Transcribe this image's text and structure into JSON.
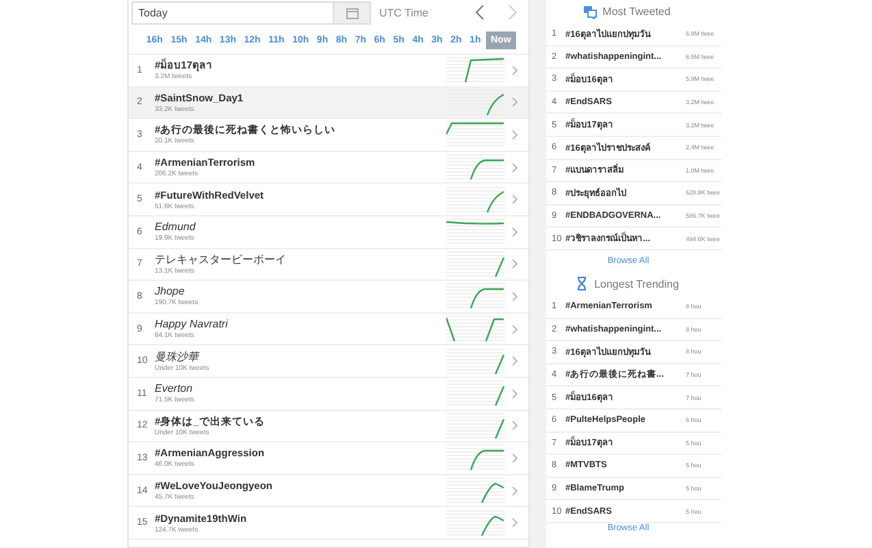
{
  "toolbar": {
    "date_field": {
      "value": "Today"
    },
    "timezone_label": "UTC Time"
  },
  "hours": [
    {
      "label": "16h",
      "selected": false
    },
    {
      "label": "15h",
      "selected": false
    },
    {
      "label": "14h",
      "selected": false
    },
    {
      "label": "13h",
      "selected": false
    },
    {
      "label": "12h",
      "selected": false
    },
    {
      "label": "11h",
      "selected": false
    },
    {
      "label": "10h",
      "selected": false
    },
    {
      "label": "9h",
      "selected": false
    },
    {
      "label": "8h",
      "selected": false
    },
    {
      "label": "7h",
      "selected": false
    },
    {
      "label": "6h",
      "selected": false
    },
    {
      "label": "5h",
      "selected": false
    },
    {
      "label": "4h",
      "selected": false
    },
    {
      "label": "3h",
      "selected": false
    },
    {
      "label": "2h",
      "selected": false
    },
    {
      "label": "1h",
      "selected": false
    },
    {
      "label": "Now",
      "selected": true
    }
  ],
  "trends": [
    {
      "rank": "1",
      "name": "#ม็อบ17ตุลา",
      "tweets": "3.2M tweets",
      "bold": true,
      "italic": false,
      "kind": "early-rise",
      "selected": false
    },
    {
      "rank": "2",
      "name": "#SaintSnow_Day1",
      "tweets": "33.2K tweets",
      "bold": true,
      "italic": false,
      "kind": "late-curve",
      "selected": true
    },
    {
      "rank": "3",
      "name": "#あ行の最後に死ね書くと怖いらしい",
      "tweets": "20.1K tweets",
      "bold": true,
      "italic": false,
      "kind": "start-rise",
      "selected": false
    },
    {
      "rank": "4",
      "name": "#ArmenianTerrorism",
      "tweets": "206.2K tweets",
      "bold": true,
      "italic": false,
      "kind": "mid-rise",
      "selected": false
    },
    {
      "rank": "5",
      "name": "#FutureWithRedVelvet",
      "tweets": "51.6K tweets",
      "bold": true,
      "italic": false,
      "kind": "late-curve",
      "selected": false
    },
    {
      "rank": "6",
      "name": "Edmund",
      "tweets": "19.9K tweets",
      "bold": false,
      "italic": true,
      "kind": "flat",
      "selected": false
    },
    {
      "rank": "7",
      "name": "テレキャスタービーボーイ",
      "tweets": "13.1K tweets",
      "bold": false,
      "italic": false,
      "kind": "late-line",
      "selected": false
    },
    {
      "rank": "8",
      "name": "Jhope",
      "tweets": "190.7K tweets",
      "bold": false,
      "italic": true,
      "kind": "mid-rise",
      "selected": false
    },
    {
      "rank": "9",
      "name": "Happy Navratri",
      "tweets": "64.1K tweets",
      "bold": false,
      "italic": true,
      "kind": "dip-rise",
      "selected": false
    },
    {
      "rank": "10",
      "name": "曼珠沙華",
      "tweets": "Under 10K tweets",
      "bold": false,
      "italic": true,
      "kind": "late-line",
      "selected": false
    },
    {
      "rank": "11",
      "name": "Everton",
      "tweets": "71.5K tweets",
      "bold": false,
      "italic": true,
      "kind": "late-line",
      "selected": false
    },
    {
      "rank": "12",
      "name": "#身体は_で出来ている",
      "tweets": "Under 10K tweets",
      "bold": true,
      "italic": false,
      "kind": "late-line",
      "selected": false
    },
    {
      "rank": "13",
      "name": "#ArmenianAggression",
      "tweets": "46.0K tweets",
      "bold": true,
      "italic": false,
      "kind": "mid-rise",
      "selected": false
    },
    {
      "rank": "14",
      "name": "#WeLoveYouJeongyeon",
      "tweets": "45.7K tweets",
      "bold": true,
      "italic": false,
      "kind": "peak",
      "selected": false
    },
    {
      "rank": "15",
      "name": "#Dynamite19thWin",
      "tweets": "124.7K tweets",
      "bold": true,
      "italic": false,
      "kind": "peak",
      "selected": false
    }
  ],
  "most_tweeted": {
    "title": "Most Tweeted",
    "items": [
      {
        "rank": "1",
        "name": "#16ตุลาไปแยกปทุมวัน",
        "count": "6.8M twee"
      },
      {
        "rank": "2",
        "name": "#whatishappeningint...",
        "count": "6.5M twee"
      },
      {
        "rank": "3",
        "name": "#ม็อบ16ตุลา",
        "count": "5.9M twee"
      },
      {
        "rank": "4",
        "name": "#EndSARS",
        "count": "3.2M twee"
      },
      {
        "rank": "5",
        "name": "#ม็อบ17ตุลา",
        "count": "3.2M twee"
      },
      {
        "rank": "6",
        "name": "#16ตุลาไปราชประสงค์",
        "count": "2.4M twee"
      },
      {
        "rank": "7",
        "name": "#แบนดาราสลิ่ม",
        "count": "1.0M twee"
      },
      {
        "rank": "8",
        "name": "#ประยุทธ์ออกไป",
        "count": "628.8K twee"
      },
      {
        "rank": "9",
        "name": "#ENDBADGOVERNA...",
        "count": "586.7K twee"
      },
      {
        "rank": "10",
        "name": "#วชิราลงกรณ์เป็นหา...",
        "count": "494.6K twee"
      }
    ],
    "browse_all": "Browse All"
  },
  "longest_trending": {
    "title": "Longest Trending",
    "items": [
      {
        "rank": "1",
        "name": "#ArmenianTerrorism",
        "count": "8 hou"
      },
      {
        "rank": "2",
        "name": "#whatishappeningint...",
        "count": "8 hou"
      },
      {
        "rank": "3",
        "name": "#16ตุลาไปแยกปทุมวัน",
        "count": "8 hou"
      },
      {
        "rank": "4",
        "name": "#あ行の最後に死ね書...",
        "count": "7 hou"
      },
      {
        "rank": "5",
        "name": "#ม็อบ16ตุลา",
        "count": "7 hou"
      },
      {
        "rank": "6",
        "name": "#PulteHelpsPeople",
        "count": "6 hou"
      },
      {
        "rank": "7",
        "name": "#ม็อบ17ตุลา",
        "count": "5 hou"
      },
      {
        "rank": "8",
        "name": "#MTVBTS",
        "count": "5 hou"
      },
      {
        "rank": "9",
        "name": "#BlameTrump",
        "count": "5 hou"
      },
      {
        "rank": "10",
        "name": "#EndSARS",
        "count": "5 hou"
      }
    ],
    "browse_all": "Browse All"
  }
}
